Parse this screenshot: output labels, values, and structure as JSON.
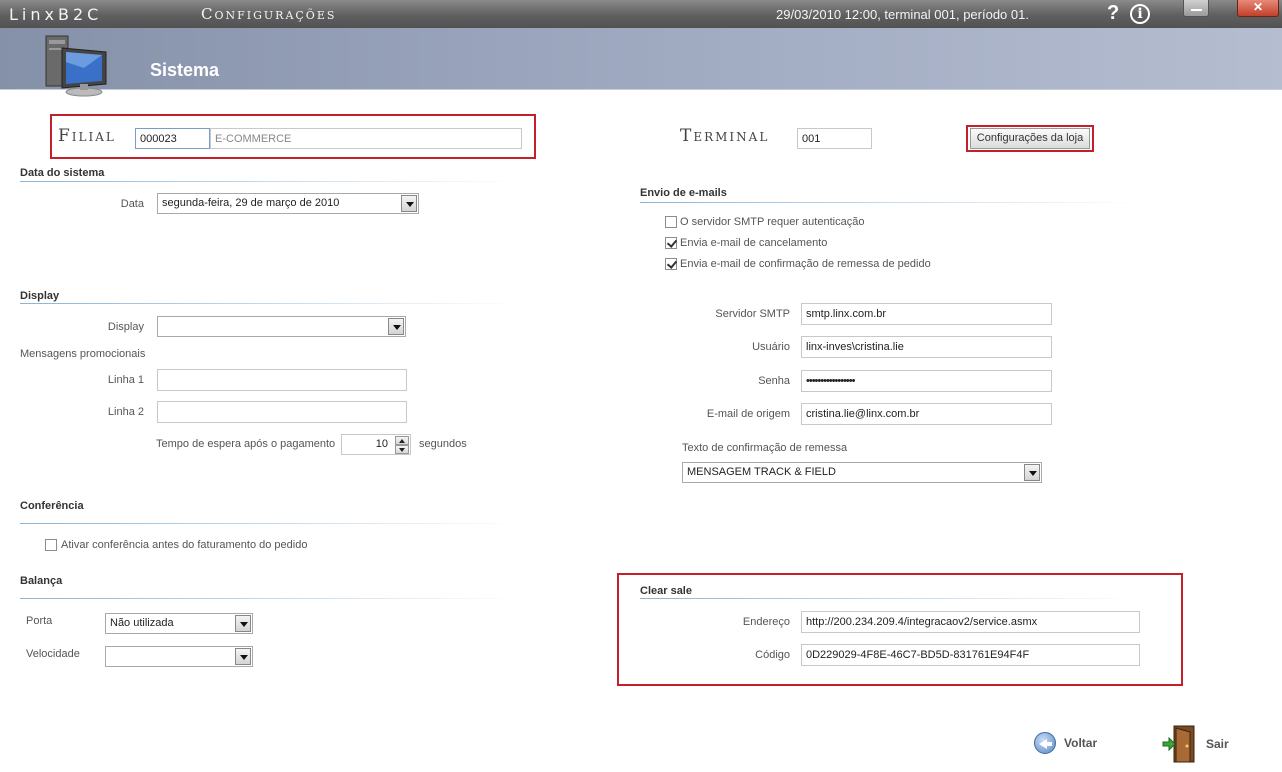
{
  "titlebar": {
    "app_name": "LinxB2C",
    "module": "Configurações",
    "status": "29/03/2010 12:00, terminal 001, período 01."
  },
  "header": {
    "title": "Sistema"
  },
  "filial": {
    "label": "Filial",
    "code": "000023",
    "name": "E-COMMERCE"
  },
  "terminal": {
    "label": "Terminal",
    "value": "001",
    "store_button": "Configurações da loja"
  },
  "data_sistema": {
    "section": "Data do sistema",
    "data_label": "Data",
    "data_value": "segunda-feira, 29 de março de 2010"
  },
  "display": {
    "section": "Display",
    "display_label": "Display",
    "display_value": "",
    "promo_label": "Mensagens promocionais",
    "linha1_label": "Linha 1",
    "linha1_value": "",
    "linha2_label": "Linha 2",
    "linha2_value": "",
    "wait_label": "Tempo de espera após o pagamento",
    "wait_value": "10",
    "wait_unit": "segundos"
  },
  "conferencia": {
    "section": "Conferência",
    "checkbox_label": "Ativar conferência antes do faturamento do pedido",
    "checked": false
  },
  "balanca": {
    "section": "Balança",
    "porta_label": "Porta",
    "porta_value": "Não utilizada",
    "velocidade_label": "Velocidade",
    "velocidade_value": ""
  },
  "email": {
    "section": "Envio de e-mails",
    "options": [
      {
        "label": "O servidor SMTP requer autenticação",
        "checked": false
      },
      {
        "label": "Envia e-mail de cancelamento",
        "checked": true
      },
      {
        "label": "Envia e-mail de confirmação de remessa de pedido",
        "checked": true
      }
    ],
    "smtp_label": "Servidor SMTP",
    "smtp_value": "smtp.linx.com.br",
    "user_label": "Usuário",
    "user_value": "linx-inves\\cristina.lie",
    "pass_label": "Senha",
    "pass_value": "•••••••••••••••••",
    "origin_label": "E-mail de origem",
    "origin_value": "cristina.lie@linx.com.br",
    "confirm_text_label": "Texto de confirmação de remessa",
    "confirm_text_value": "MENSAGEM TRACK & FIELD"
  },
  "clear_sale": {
    "section": "Clear sale",
    "endereco_label": "Endereço",
    "endereco_value": "http://200.234.209.4/integracaov2/service.asmx",
    "codigo_label": "Código",
    "codigo_value": "0D229029-4F8E-46C7-BD5D-831761E94F4F"
  },
  "footer": {
    "back_label": "Voltar",
    "exit_label": "Sair"
  },
  "colors": {
    "highlight_border": "#c4202c",
    "header_band": "#9aa5bd"
  }
}
